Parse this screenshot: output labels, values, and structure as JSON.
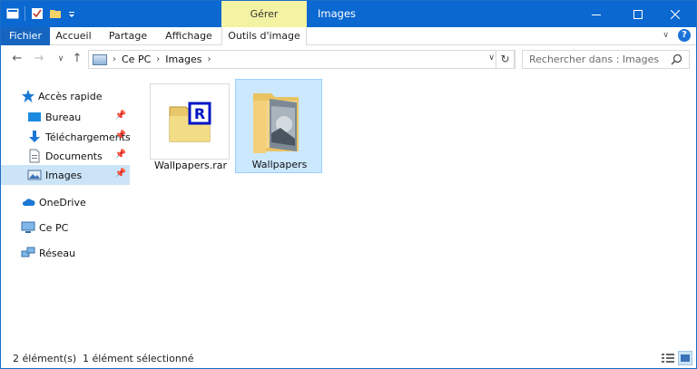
{
  "titlebar": {
    "context_tab_title": "Gérer",
    "window_title": "Images",
    "qat_icons": [
      "properties-icon",
      "checkmark-icon",
      "new-folder-icon",
      "customize-qat-icon"
    ],
    "window_buttons": [
      "minimize-icon",
      "maximize-icon",
      "close-icon"
    ]
  },
  "ribbon": {
    "tabs": [
      "Fichier",
      "Accueil",
      "Partage",
      "Affichage",
      "Outils d'image"
    ]
  },
  "address": {
    "crumbs": [
      "Ce PC",
      "Images"
    ],
    "search_placeholder": "Rechercher dans : Images"
  },
  "nav": {
    "items": [
      {
        "label": "Accès rapide",
        "icon": "star-icon",
        "selected": false,
        "pinned": false
      },
      {
        "label": "Bureau",
        "icon": "desktop-icon",
        "selected": false,
        "pinned": true
      },
      {
        "label": "Téléchargements",
        "icon": "download-icon",
        "selected": false,
        "pinned": true
      },
      {
        "label": "Documents",
        "icon": "document-icon",
        "selected": false,
        "pinned": true
      },
      {
        "label": "Images",
        "icon": "pictures-icon",
        "selected": true,
        "pinned": true
      },
      {
        "label": "OneDrive",
        "icon": "cloud-icon",
        "selected": false,
        "pinned": false
      },
      {
        "label": "Ce PC",
        "icon": "computer-icon",
        "selected": false,
        "pinned": false
      },
      {
        "label": "Réseau",
        "icon": "network-icon",
        "selected": false,
        "pinned": false
      }
    ]
  },
  "files": [
    {
      "name": "Wallpapers.rar",
      "icon": "rar-archive-icon",
      "selected": false
    },
    {
      "name": "Wallpapers",
      "icon": "image-folder-icon",
      "selected": true
    }
  ],
  "status": {
    "count": "2 élément(s)",
    "selection": "1 élément sélectionné"
  },
  "colors": {
    "titlebar": "#0a68d0",
    "context_tab": "#f4f3a3",
    "file_tab": "#1565c0",
    "selection": "#cce8ff",
    "nav_selection": "#cce4f7"
  }
}
